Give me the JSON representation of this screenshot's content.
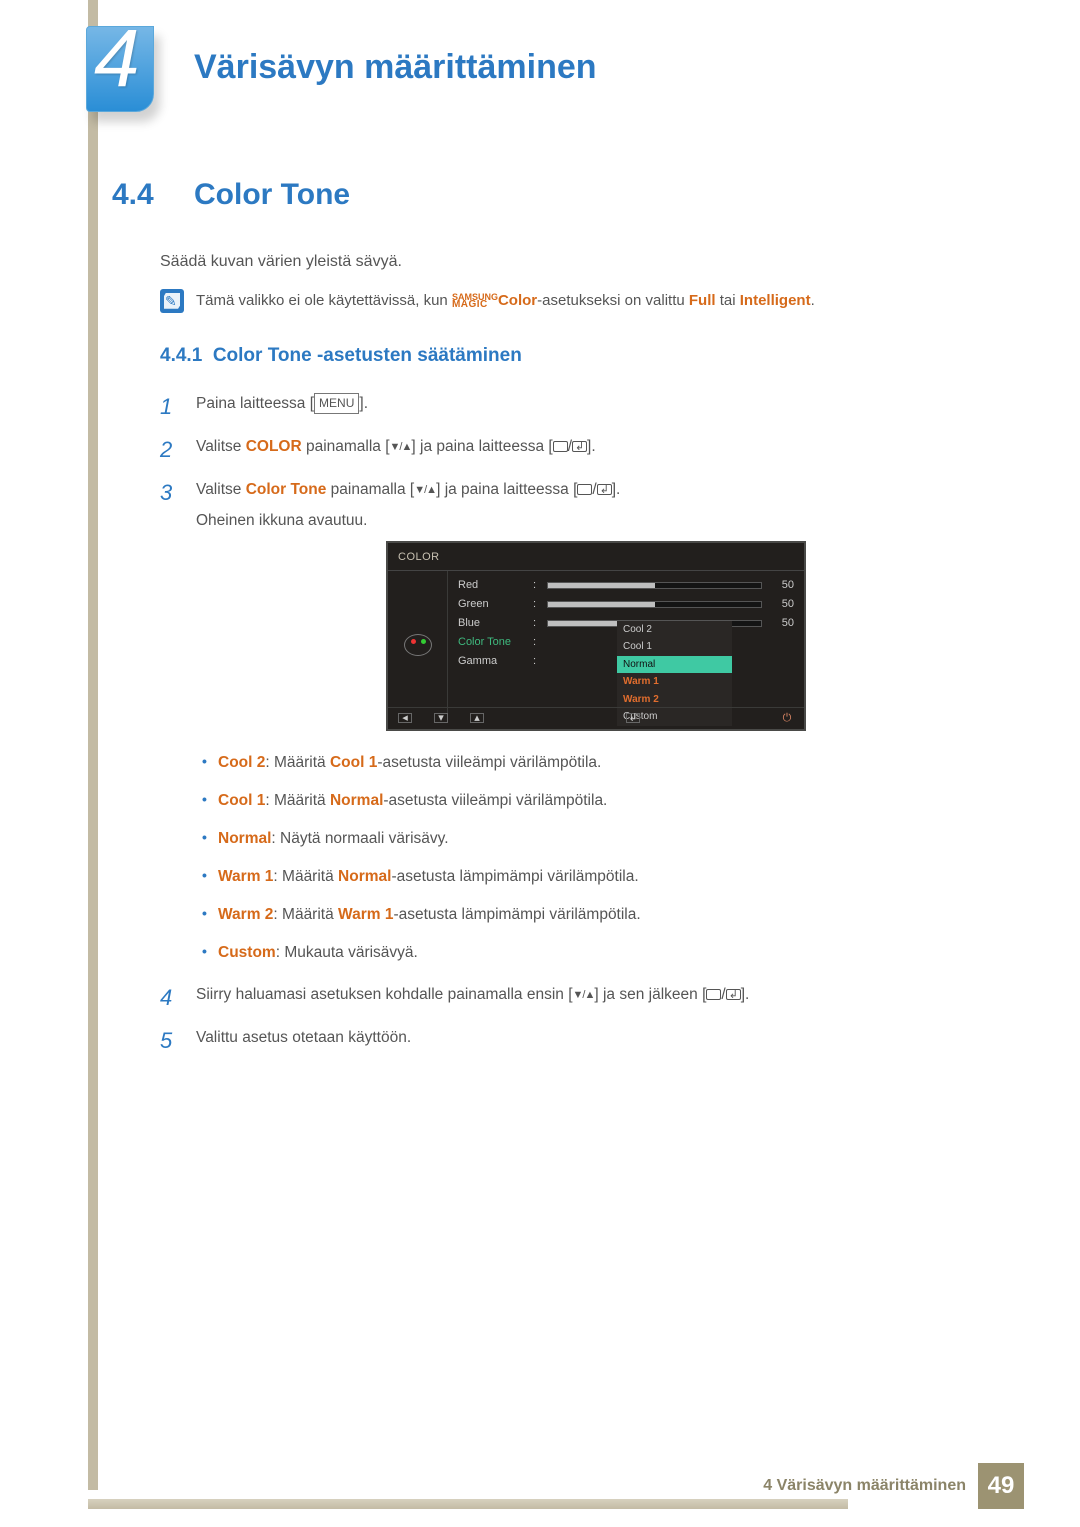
{
  "header": {
    "chapter_number": "4",
    "chapter_title": "Värisävyn määrittäminen"
  },
  "section": {
    "number": "4.4",
    "title": "Color Tone",
    "intro": "Säädä kuvan värien yleistä sävyä.",
    "note": {
      "prefix": "Tämä valikko ei ole käytettävissä, kun ",
      "magic_top": "SAMSUNG",
      "magic_bottom": "MAGIC",
      "magic_word": "Color",
      "mid": "-asetukseksi on valittu ",
      "kw1": "Full",
      "or": " tai ",
      "kw2": "Intelligent",
      "suffix": "."
    }
  },
  "subsection": {
    "number": "4.4.1",
    "title": "Color Tone -asetusten säätäminen"
  },
  "steps": {
    "s1": {
      "n": "1",
      "a": "Paina laitteessa [",
      "menu": "MENU",
      "b": "]."
    },
    "s2": {
      "n": "2",
      "a": "Valitse ",
      "kw": "COLOR",
      "b": " painamalla [",
      "c": "] ja paina laitteessa [",
      "d": "]."
    },
    "s3": {
      "n": "3",
      "a": "Valitse ",
      "kw": "Color Tone",
      "b": " painamalla [",
      "c": "] ja paina laitteessa [",
      "d": "].",
      "sub": "Oheinen ikkuna avautuu."
    },
    "s4": {
      "n": "4",
      "a": "Siirry haluamasi asetuksen kohdalle painamalla ensin [",
      "b": "] ja sen jälkeen [",
      "c": "]."
    },
    "s5": {
      "n": "5",
      "a": "Valittu asetus otetaan käyttöön."
    }
  },
  "osd": {
    "title": "COLOR",
    "rows": {
      "red": {
        "label": "Red",
        "value": "50"
      },
      "green": {
        "label": "Green",
        "value": "50"
      },
      "blue": {
        "label": "Blue",
        "value": "50"
      }
    },
    "color_tone_label": "Color Tone",
    "gamma_label": "Gamma",
    "dropdown": {
      "o1": "Cool 2",
      "o2": "Cool 1",
      "o3": "Normal",
      "o4": "Warm 1",
      "o5": "Warm 2",
      "o6": "Custom"
    }
  },
  "bullets": {
    "b1": {
      "kw": "Cool 2",
      "a": ": Määritä ",
      "kw2": "Cool 1",
      "b": "-asetusta viileämpi värilämpötila."
    },
    "b2": {
      "kw": "Cool 1",
      "a": ": Määritä ",
      "kw2": "Normal",
      "b": "-asetusta viileämpi värilämpötila."
    },
    "b3": {
      "kw": "Normal",
      "a": ": Näytä normaali värisävy."
    },
    "b4": {
      "kw": "Warm 1",
      "a": ": Määritä ",
      "kw2": "Normal",
      "b": "-asetusta lämpimämpi värilämpötila."
    },
    "b5": {
      "kw": "Warm 2",
      "a": ": Määritä ",
      "kw2": "Warm 1",
      "b": "-asetusta lämpimämpi värilämpötila."
    },
    "b6": {
      "kw": "Custom",
      "a": ": Mukauta värisävyä."
    }
  },
  "footer": {
    "text": "4 Värisävyn määrittäminen",
    "page": "49"
  }
}
